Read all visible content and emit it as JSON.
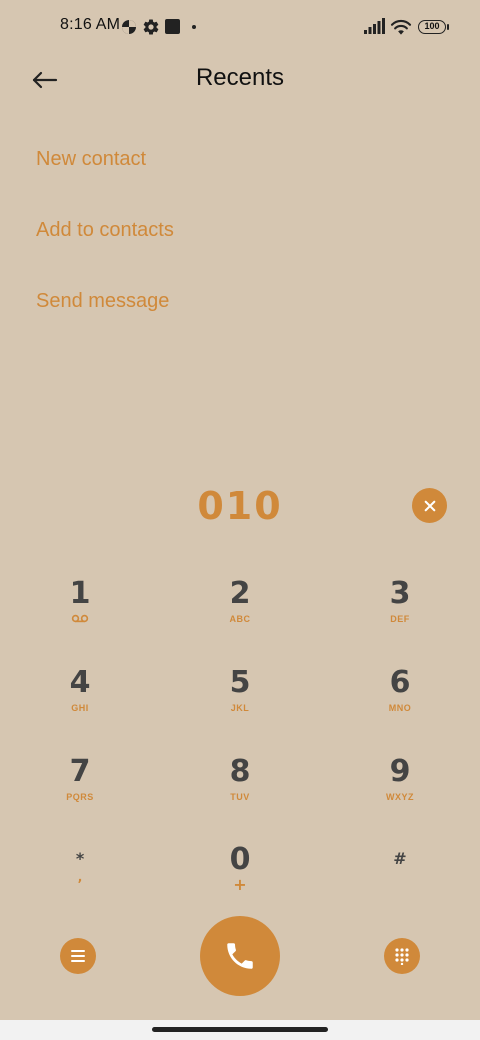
{
  "status_bar": {
    "time": "8:16 AM",
    "battery": "100",
    "icons": [
      "pinwheel-icon",
      "gear-icon",
      "square-icon",
      "signal-icon",
      "wifi-icon",
      "battery-icon"
    ]
  },
  "header": {
    "title": "Recents",
    "back_icon": "arrow-left-icon"
  },
  "actions": [
    {
      "label": "New contact"
    },
    {
      "label": "Add to contacts"
    },
    {
      "label": "Send message"
    }
  ],
  "dialer": {
    "number": "010",
    "clear_icon": "close-icon"
  },
  "keypad": [
    {
      "digit": "1",
      "letters": ""
    },
    {
      "digit": "2",
      "letters": "ABC"
    },
    {
      "digit": "3",
      "letters": "DEF"
    },
    {
      "digit": "4",
      "letters": "GHI"
    },
    {
      "digit": "5",
      "letters": "JKL"
    },
    {
      "digit": "6",
      "letters": "MNO"
    },
    {
      "digit": "7",
      "letters": "PQRS"
    },
    {
      "digit": "8",
      "letters": "TUV"
    },
    {
      "digit": "9",
      "letters": "WXYZ"
    },
    {
      "digit": "*",
      "letters": ","
    },
    {
      "digit": "0",
      "letters": "+"
    },
    {
      "digit": "#",
      "letters": ""
    }
  ],
  "bottom_controls": {
    "menu_icon": "menu-icon",
    "call_icon": "phone-icon",
    "dialpad_icon": "dialpad-icon"
  },
  "colors": {
    "background": "#d6c6b1",
    "accent": "#d0893a",
    "digit": "#444444"
  }
}
